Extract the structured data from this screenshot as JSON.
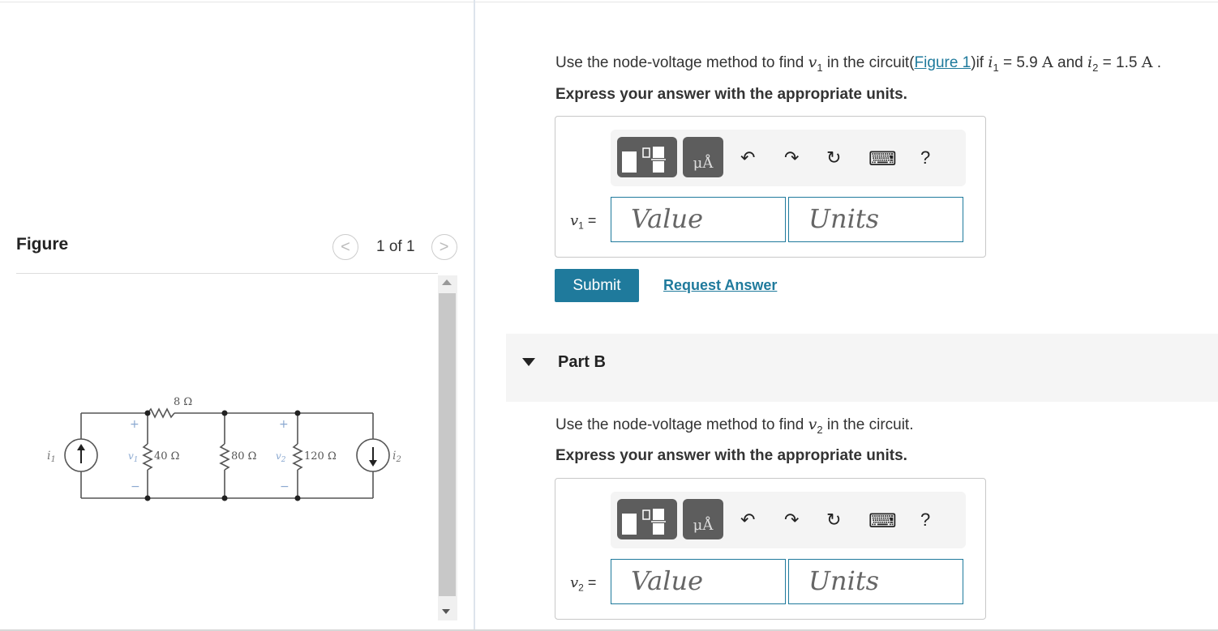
{
  "figure": {
    "title": "Figure",
    "pager_text": "1 of 1",
    "prev": "<",
    "next": ">",
    "labels": {
      "r8": "8 Ω",
      "r40": "40 Ω",
      "r80": "80 Ω",
      "r120": "120 Ω",
      "i1": "i",
      "i1_sub": "1",
      "i2": "i",
      "i2_sub": "2",
      "v1": "v",
      "v1_sub": "1",
      "v2": "v",
      "v2_sub": "2",
      "plus": "+",
      "minus": "−"
    }
  },
  "part_a": {
    "q_prefix": "Use the node-voltage method to find ",
    "q_var": "v",
    "q_var_sub": "1",
    "q_mid": " in the circuit(",
    "q_link": "Figure 1",
    "q_after_link": ")if ",
    "i1": "i",
    "i1_sub": "1",
    "i1_val": " = 5.9 ",
    "unit_a1": "A",
    "and": " and ",
    "i2": "i",
    "i2_sub": "2",
    "i2_val": " = 1.5 ",
    "unit_a2": "A",
    "end": " .",
    "instruction": "Express your answer with the appropriate units.",
    "var_label": "v",
    "var_sub": "1",
    "eq": " =",
    "value_placeholder": "Value",
    "units_placeholder": "Units",
    "submit_label": "Submit",
    "request_label": "Request Answer"
  },
  "toolbar": {
    "unit_glyph": "μÅ",
    "undo": "↶",
    "redo": "↷",
    "reset": "↻",
    "keyboard": "⌨",
    "help": "?"
  },
  "part_b": {
    "title": "Part B",
    "q_prefix": "Use the node-voltage method to find ",
    "q_var": "v",
    "q_var_sub": "2",
    "q_suffix": " in the circuit.",
    "instruction": "Express your answer with the appropriate units.",
    "var_label": "v",
    "var_sub": "2",
    "eq": " =",
    "value_placeholder": "Value",
    "units_placeholder": "Units"
  },
  "colors": {
    "accent": "#1f7a9c",
    "toolbar_button": "#5d5d5d"
  }
}
